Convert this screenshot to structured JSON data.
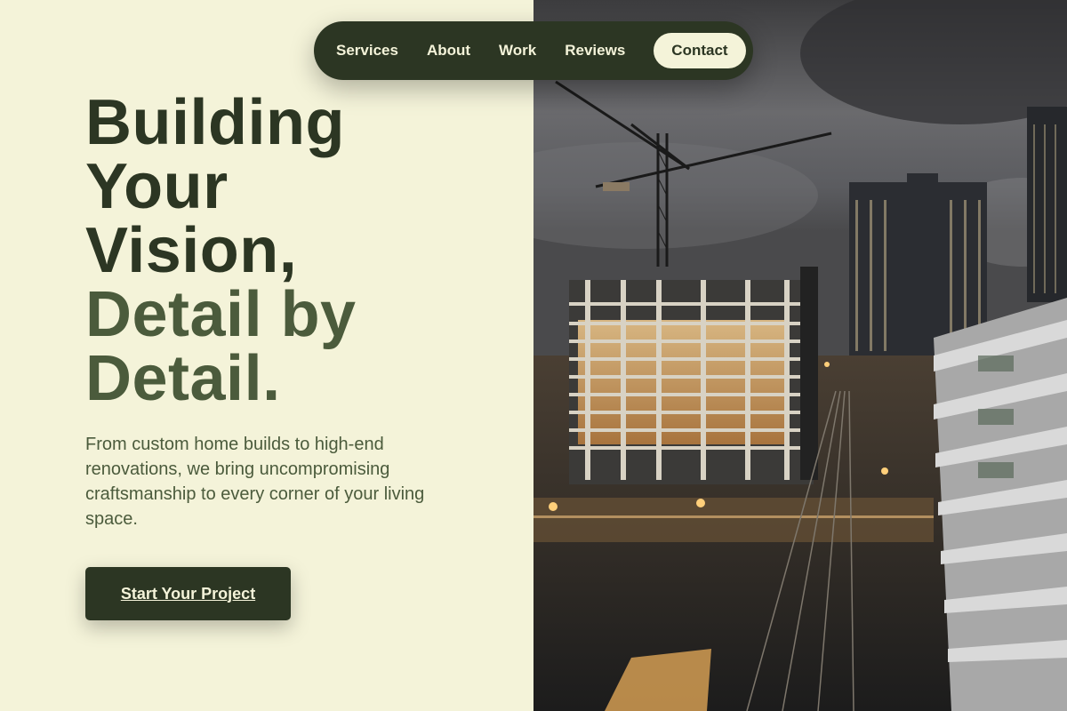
{
  "nav": {
    "items": [
      {
        "label": "Services"
      },
      {
        "label": "About"
      },
      {
        "label": "Work"
      },
      {
        "label": "Reviews"
      }
    ],
    "contact_label": "Contact"
  },
  "hero": {
    "headline_lines": [
      "Building",
      "Your",
      "Vision,"
    ],
    "headline_accent_lines": [
      "Detail by",
      "Detail."
    ],
    "subtext": "From custom home builds to high-end renovations, we bring uncompromising craftsmanship to every corner of your living space.",
    "cta_label": "Start Your Project"
  },
  "colors": {
    "background": "#f4f3d9",
    "dark_green": "#2c3623",
    "accent_green": "#4b5b3c"
  }
}
